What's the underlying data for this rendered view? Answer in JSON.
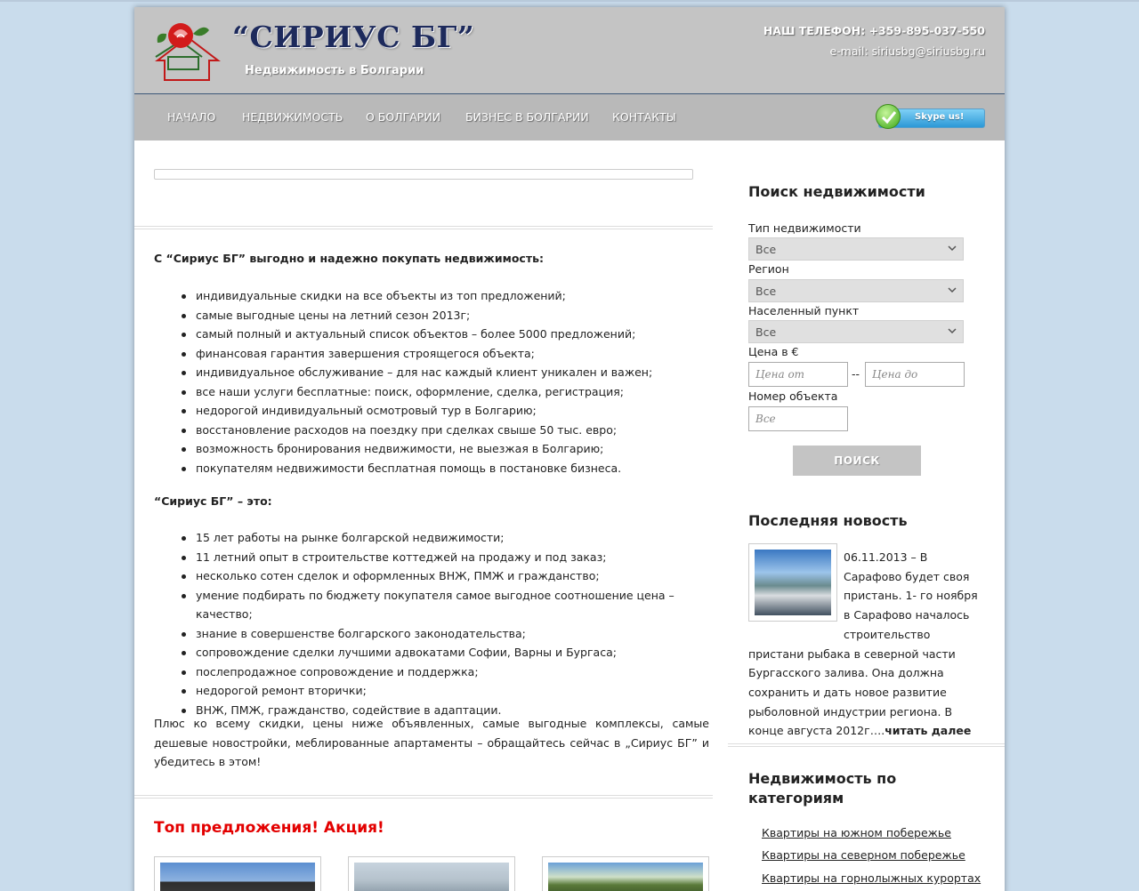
{
  "header": {
    "logo_title": "“СИРИУС БГ”",
    "logo_subtitle": "Недвижимость в Болгарии",
    "phone": "НАШ ТЕЛЕФОН: +359-895-037-550",
    "email": "e-mail: siriusbg@siriusbg.ru"
  },
  "nav": {
    "items": [
      "НАЧАЛО",
      "НЕДВИЖИМОСТЬ",
      "О БОЛГАРИИ",
      "БИЗНЕС В БОЛГАРИИ",
      "КОНТАКТЫ"
    ],
    "skype_label": "Skype us!"
  },
  "main": {
    "intro": "С “Сириус БГ” выгодно и надежно покупать недвижимость:",
    "list1": [
      "индивидуальные скидки на все объекты из топ предложений;",
      "самые выгодные цены на летний сезон 2013г;",
      "самый полный и актуальный список объектов – более 5000 предложений;",
      "финансовая гарантия завершения строящегося объекта;",
      "индивидуальное обслуживание – для нас каждый клиент уникален и важен;",
      "все наши услуги бесплатные: поиск, оформление, сделка, регистрация;",
      "недорогой индивидуальный осмотровый тур в Болгарию;",
      "восстановление расходов на поездку при сделках свыше 50 тыс. евро;",
      "возможность бронирования недвижимости, не выезжая в Болгарию;",
      "покупателям недвижимости бесплатная помощь в постановке бизнеса."
    ],
    "intro2": "“Сириус БГ” – это:",
    "list2": [
      "15 лет работы на рынке болгарской недвижимости;",
      "11 летний опыт в строительстве коттеджей на продажу и под заказ;",
      "несколько сотен сделок и оформленных ВНЖ, ПМЖ и гражданство;",
      "умение подбирать по бюджету покупателя самое выгодное соотношение цена – качество;",
      "знание в совершенстве болгарского законодательства;",
      "сопровождение сделки лучшими адвокатами Софии, Варны и Бургаса;",
      "послепродажное сопровождение и поддержка;",
      "недорогой ремонт вторички;",
      "ВНЖ, ПМЖ, гражданство, содействие в адаптации."
    ],
    "closing": "Плюс ко всему скидки, цены ниже объявленных, самые выгодные комплексы, самые дешевые новостройки, меблированные апартаменты – обращайтесь сейчас в „Сириус БГ” и убедитесь в этом!",
    "top_offers_title": "Топ предложения! Акция!"
  },
  "search": {
    "heading": "Поиск недвижимости",
    "type_label": "Тип недвижимости",
    "type_value": "Все",
    "region_label": "Регион",
    "region_value": "Все",
    "place_label": "Населенный пункт",
    "place_value": "Все",
    "price_label": "Цена в €",
    "price_from_placeholder": "Цена от",
    "price_dash": "--",
    "price_to_placeholder": "Цена до",
    "number_label": "Номер объекта",
    "number_placeholder": "Все",
    "button": "ПОИСК"
  },
  "news": {
    "heading": "Последняя новость",
    "text": "06.11.2013 – В Сарафово будет своя пристань. 1- го ноября в Сарафово началось строительство пристани рыбака в северной части Бургасского залива. Она должна сохранить и дать новое развитие рыболовной индустрии региона. В конце августа 2012г….",
    "more": "читать далее"
  },
  "categories": {
    "heading": "Недвижимость по категориям",
    "links": [
      "Квартиры на южном побережье",
      "Квартиры на северном побережье",
      "Квартиры на горнолыжных курортах"
    ]
  }
}
